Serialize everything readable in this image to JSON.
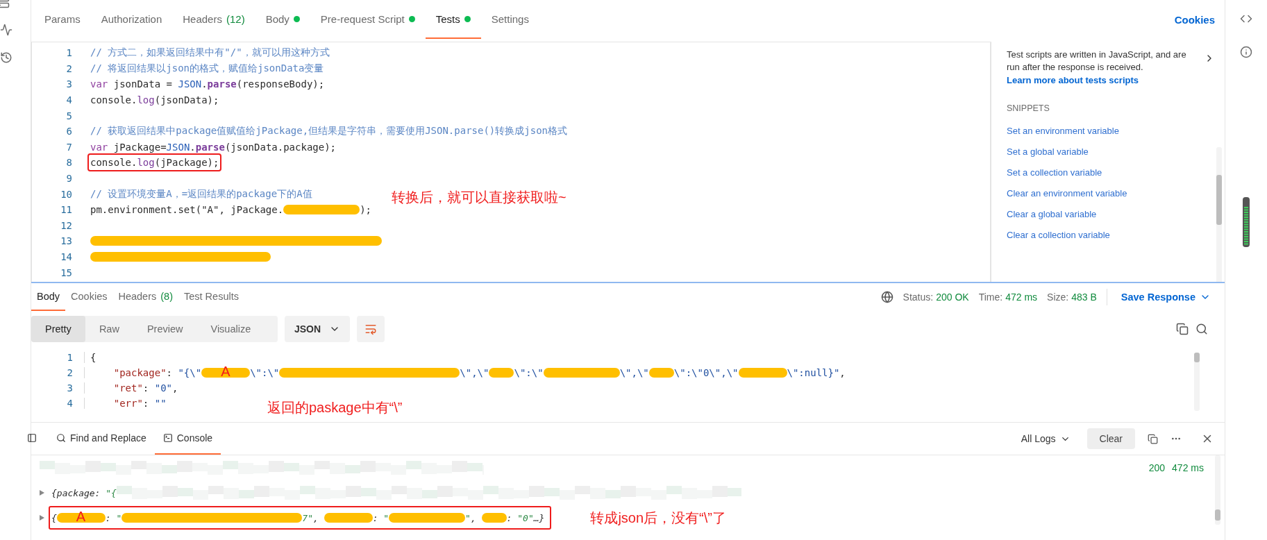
{
  "request_tabs": [
    {
      "label": "Params",
      "selected": false
    },
    {
      "label": "Authorization",
      "selected": false
    },
    {
      "label": "Headers",
      "count": "(12)",
      "selected": false
    },
    {
      "label": "Body",
      "dot": true,
      "selected": false
    },
    {
      "label": "Pre-request Script",
      "dot": true,
      "selected": false
    },
    {
      "label": "Tests",
      "dot": true,
      "selected": true
    },
    {
      "label": "Settings",
      "selected": false
    }
  ],
  "cookies_link": "Cookies",
  "editor": {
    "annotation": "转换后，就可以直接获取啦~",
    "lines": [
      {
        "number": "1",
        "highlighted": false,
        "tokens": [
          {
            "kind": "comment",
            "text": "// 方式二，如果返回结果中有\"/\"，就可以用这种方式"
          }
        ]
      },
      {
        "number": "2",
        "highlighted": false,
        "tokens": [
          {
            "kind": "comment",
            "text": "// 将返回结果以json的格式，赋值给jsonData变量"
          }
        ]
      },
      {
        "number": "3",
        "highlighted": false,
        "tokens": [
          {
            "kind": "keyword",
            "text": "var"
          },
          {
            "kind": "plain",
            "text": " jsonData = "
          },
          {
            "kind": "builtin",
            "text": "JSON"
          },
          {
            "kind": "plain",
            "text": "."
          },
          {
            "kind": "method",
            "text": "parse"
          },
          {
            "kind": "plain",
            "text": "(responseBody);"
          }
        ]
      },
      {
        "number": "4",
        "highlighted": false,
        "tokens": [
          {
            "kind": "plain",
            "text": "console."
          },
          {
            "kind": "method",
            "text": "log"
          },
          {
            "kind": "plain",
            "text": "(jsonData);"
          }
        ]
      },
      {
        "number": "5"
      },
      {
        "number": "6",
        "highlighted": false,
        "tokens": [
          {
            "kind": "comment",
            "text": "// 获取返回结果中package值赋值给jPackage,但结果是字符串，需要使用JSON.parse()转换成json格式"
          }
        ]
      },
      {
        "number": "7",
        "highlighted": false,
        "tokens": [
          {
            "kind": "keyword",
            "text": "var"
          },
          {
            "kind": "plain",
            "text": " jPackage="
          },
          {
            "kind": "builtin",
            "text": "JSON"
          },
          {
            "kind": "plain",
            "text": "."
          },
          {
            "kind": "method",
            "text": "parse"
          },
          {
            "kind": "plain",
            "text": "(jsonData.package);"
          }
        ]
      },
      {
        "number": "8",
        "highlighted": true,
        "tokens": [
          {
            "kind": "plain",
            "text": "console."
          },
          {
            "kind": "method",
            "text": "log"
          },
          {
            "kind": "plain",
            "text": "(jPackage);"
          }
        ]
      },
      {
        "number": "9"
      },
      {
        "number": "10",
        "highlighted": false,
        "tokens": [
          {
            "kind": "comment",
            "text": "// 设置环境变量A，=返回结果的package下的A值"
          }
        ]
      },
      {
        "number": "11",
        "highlighted": false,
        "tokens": [
          {
            "kind": "plain",
            "text": "pm.environment.set(\"A\", jPackage."
          },
          {
            "kind": "redaction"
          },
          {
            "kind": "plain",
            "text": ");"
          }
        ]
      },
      {
        "number": "12"
      },
      {
        "number": "13",
        "tokens": [
          {
            "kind": "redaction"
          }
        ]
      },
      {
        "number": "14",
        "tokens": [
          {
            "kind": "redaction"
          }
        ]
      },
      {
        "number": "15"
      }
    ]
  },
  "snippets_panel": {
    "description": "Test scripts are written in JavaScript, and are run after the response is received.",
    "link": "Learn more about tests scripts",
    "heading": "SNIPPETS",
    "items": [
      "Set an environment variable",
      "Set a global variable",
      "Set a collection variable",
      "Clear an environment variable",
      "Clear a global variable",
      "Clear a collection variable"
    ]
  },
  "response": {
    "tabs": [
      {
        "label": "Body",
        "selected": true
      },
      {
        "label": "Cookies",
        "selected": false
      },
      {
        "label": "Headers",
        "count": "(8)",
        "selected": false
      },
      {
        "label": "Test Results",
        "selected": false
      }
    ],
    "status": {
      "status_label": "Status:",
      "status_value": "200 OK",
      "time_label": "Time:",
      "time_value": "472 ms",
      "size_label": "Size:",
      "size_value": "483 B"
    },
    "save_button": "Save Response",
    "views": [
      {
        "label": "Pretty",
        "selected": true
      },
      {
        "label": "Raw",
        "selected": false
      },
      {
        "label": "Preview",
        "selected": false
      },
      {
        "label": "Visualize",
        "selected": false
      }
    ],
    "format": "JSON",
    "annotation": "返回的paskage中有“\\”",
    "lines": [
      {
        "number": "1",
        "tokens": [
          {
            "kind": "plain",
            "text": "{"
          }
        ]
      },
      {
        "number": "2",
        "tokens": [
          {
            "kind": "key",
            "text": "    \"package\""
          },
          {
            "kind": "plain",
            "text": ": "
          },
          {
            "kind": "value",
            "text": "\"{\\\""
          },
          {
            "kind": "redaction",
            "label": "A"
          },
          {
            "kind": "value",
            "text": "\\\":\\\""
          },
          {
            "kind": "redaction"
          },
          {
            "kind": "value",
            "text": "\\\",\\\""
          },
          {
            "kind": "redaction"
          },
          {
            "kind": "value",
            "text": "\\\":\\\""
          },
          {
            "kind": "redaction"
          },
          {
            "kind": "value",
            "text": "\\\",\\\""
          },
          {
            "kind": "redaction"
          },
          {
            "kind": "value",
            "text": "\\\":\\\"0\\\",\\\""
          },
          {
            "kind": "redaction"
          },
          {
            "kind": "value",
            "text": "\\\":null}\""
          },
          {
            "kind": "plain",
            "text": ","
          }
        ]
      },
      {
        "number": "3",
        "tokens": [
          {
            "kind": "key",
            "text": "    \"ret\""
          },
          {
            "kind": "plain",
            "text": ": "
          },
          {
            "kind": "value",
            "text": "\"0\""
          },
          {
            "kind": "plain",
            "text": ","
          }
        ]
      },
      {
        "number": "4",
        "tokens": [
          {
            "kind": "key",
            "text": "    \"err\""
          },
          {
            "kind": "plain",
            "text": ": "
          },
          {
            "kind": "value",
            "text": "\"\""
          }
        ]
      }
    ]
  },
  "console": {
    "tabs": [
      {
        "label": "Find and Replace",
        "selected": false
      },
      {
        "label": "Console",
        "selected": true
      }
    ],
    "filter": "All Logs",
    "clear_button": "Clear",
    "status_code": "200",
    "time": "472 ms",
    "annotation": "转成json后，没有“\\”了",
    "rows": [
      {
        "kind": "blurred"
      },
      {
        "kind": "log",
        "highlighted": false,
        "tokens": [
          {
            "kind": "italic",
            "text": "{package: "
          },
          {
            "kind": "string",
            "text": "\"{"
          },
          {
            "kind": "blur"
          }
        ]
      },
      {
        "kind": "log",
        "highlighted": true,
        "tokens": [
          {
            "kind": "italic",
            "text": "{"
          },
          {
            "kind": "redaction",
            "label": "A"
          },
          {
            "kind": "italic",
            "text": ": "
          },
          {
            "kind": "string",
            "text": "\""
          },
          {
            "kind": "redaction"
          },
          {
            "kind": "string",
            "text": "7\""
          },
          {
            "kind": "italic",
            "text": ", "
          },
          {
            "kind": "redaction"
          },
          {
            "kind": "italic",
            "text": ": "
          },
          {
            "kind": "string",
            "text": "\""
          },
          {
            "kind": "redaction"
          },
          {
            "kind": "string",
            "text": "\""
          },
          {
            "kind": "italic",
            "text": ", "
          },
          {
            "kind": "redaction"
          },
          {
            "kind": "italic",
            "text": ": "
          },
          {
            "kind": "string",
            "text": "\"0\""
          },
          {
            "kind": "italic",
            "text": "…}"
          }
        ]
      }
    ]
  }
}
